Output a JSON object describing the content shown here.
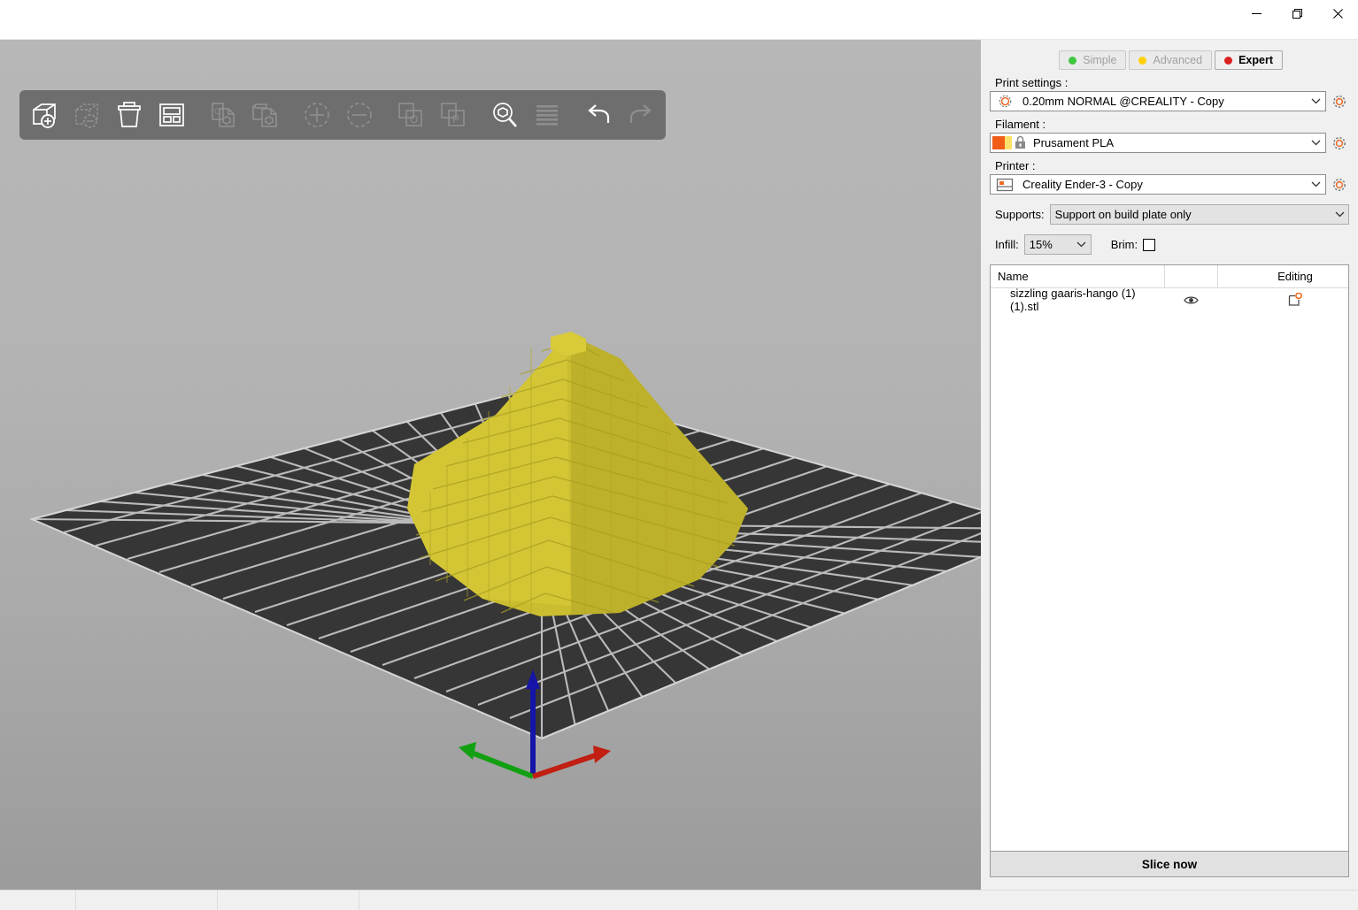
{
  "window": {
    "minimize_label": "Minimize",
    "maximize_label": "Restore",
    "close_label": "Close"
  },
  "toolbar": {
    "items": [
      {
        "name": "add-icon",
        "label": "Add...",
        "enabled": true
      },
      {
        "name": "delete-icon",
        "label": "Delete",
        "enabled": false
      },
      {
        "name": "delete-all-icon",
        "label": "Delete all",
        "enabled": true
      },
      {
        "name": "arrange-icon",
        "label": "Arrange",
        "enabled": true
      },
      {
        "name": "copy-icon",
        "label": "Copy",
        "enabled": false
      },
      {
        "name": "paste-icon",
        "label": "Paste",
        "enabled": false
      },
      {
        "name": "add-instance-icon",
        "label": "Add instance",
        "enabled": false
      },
      {
        "name": "remove-instance-icon",
        "label": "Remove instance",
        "enabled": false
      },
      {
        "name": "split-objects-icon",
        "label": "Split to objects",
        "enabled": false
      },
      {
        "name": "split-parts-icon",
        "label": "Split to parts",
        "enabled": false
      },
      {
        "name": "search-icon",
        "label": "Search",
        "enabled": true
      },
      {
        "name": "layers-icon",
        "label": "Variable layer height",
        "enabled": false
      },
      {
        "name": "undo-icon",
        "label": "Undo",
        "enabled": true
      },
      {
        "name": "redo-icon",
        "label": "Redo",
        "enabled": false
      }
    ]
  },
  "sidebar": {
    "modes": [
      {
        "label": "Simple",
        "color": "#3fc63f",
        "active": false
      },
      {
        "label": "Advanced",
        "color": "#ffd105",
        "active": false
      },
      {
        "label": "Expert",
        "color": "#da2020",
        "active": true
      }
    ],
    "print_settings": {
      "label": "Print settings :",
      "value": "0.20mm NORMAL @CREALITY - Copy"
    },
    "filament": {
      "label": "Filament :",
      "value": "Prusament PLA",
      "swatch_a": "#f25c19",
      "swatch_b": "#fbe06a"
    },
    "printer": {
      "label": "Printer :",
      "value": "Creality Ender-3 - Copy"
    },
    "supports": {
      "label": "Supports:",
      "value": "Support on build plate only"
    },
    "infill": {
      "label": "Infill:",
      "value": "15%"
    },
    "brim": {
      "label": "Brim:",
      "checked": false
    },
    "object_list": {
      "columns": {
        "name": "Name",
        "editing": "Editing"
      },
      "rows": [
        {
          "name": "sizzling gaaris-hango (1) (1).stl",
          "visible": true,
          "editing_icon": "edit-object-icon"
        }
      ]
    },
    "slice_button": "Slice now"
  },
  "viewport": {
    "background_top": "#b7b7b7",
    "background_bottom": "#9b9b9b",
    "bed_color": "#363636",
    "bed_grid_color": "#c8c8c8",
    "model_color": "#c9bc2f",
    "axes": [
      {
        "name": "x-axis",
        "color": "#c21f13"
      },
      {
        "name": "y-axis",
        "color": "#12a012"
      },
      {
        "name": "z-axis",
        "color": "#1515a8"
      }
    ]
  },
  "statusbar": {
    "text": ""
  }
}
